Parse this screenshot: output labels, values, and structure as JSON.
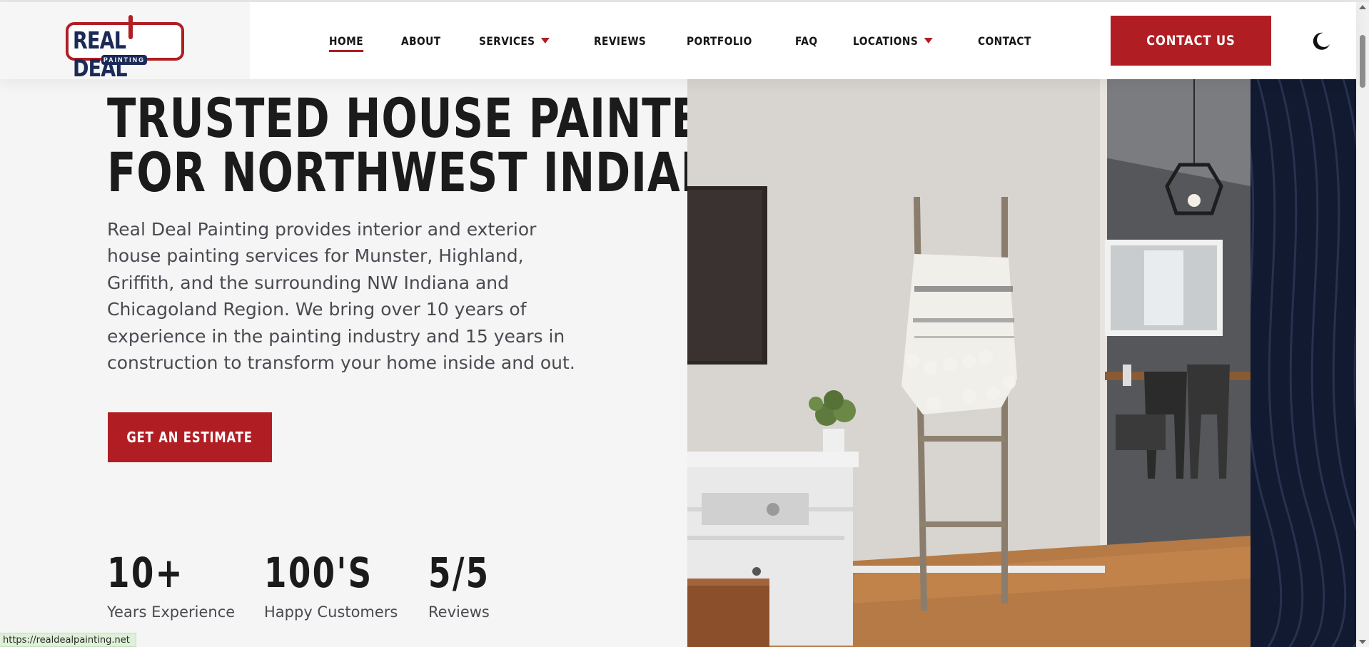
{
  "brand": {
    "logo_text": "REAL DEAL",
    "logo_subtext": "PAINTING",
    "colors": {
      "accent": "#b01e24",
      "navy": "#1b2a57",
      "dark_panel": "#111a30"
    }
  },
  "nav": {
    "items": [
      {
        "label": "HOME",
        "active": true,
        "has_dropdown": false
      },
      {
        "label": "ABOUT",
        "active": false,
        "has_dropdown": false
      },
      {
        "label": "SERVICES",
        "active": false,
        "has_dropdown": true
      },
      {
        "label": "REVIEWS",
        "active": false,
        "has_dropdown": false
      },
      {
        "label": "PORTFOLIO",
        "active": false,
        "has_dropdown": false
      },
      {
        "label": "FAQ",
        "active": false,
        "has_dropdown": false
      },
      {
        "label": "LOCATIONS",
        "active": false,
        "has_dropdown": true
      },
      {
        "label": "CONTACT",
        "active": false,
        "has_dropdown": false
      }
    ],
    "contact_button": "CONTACT US",
    "theme_toggle_icon": "moon-icon"
  },
  "hero": {
    "title_line1": "TRUSTED HOUSE PAINTERS",
    "title_line2": "FOR NORTHWEST INDIANA",
    "description": "Real Deal Painting provides interior and exterior house painting services for Munster, Highland, Griffith, and the surrounding NW Indiana and Chicagoland Region. We bring over 10 years of experience in the painting industry and 15 years in construction to transform your home inside and out.",
    "cta_button": "GET AN ESTIMATE",
    "image_icon": "interior-room-photo"
  },
  "stats": [
    {
      "value": "10+",
      "label": "Years Experience"
    },
    {
      "value": "100'S",
      "label": "Happy Customers"
    },
    {
      "value": "5/5",
      "label": "Reviews"
    }
  ],
  "status_bar": {
    "url": "https://realdealpainting.net"
  }
}
